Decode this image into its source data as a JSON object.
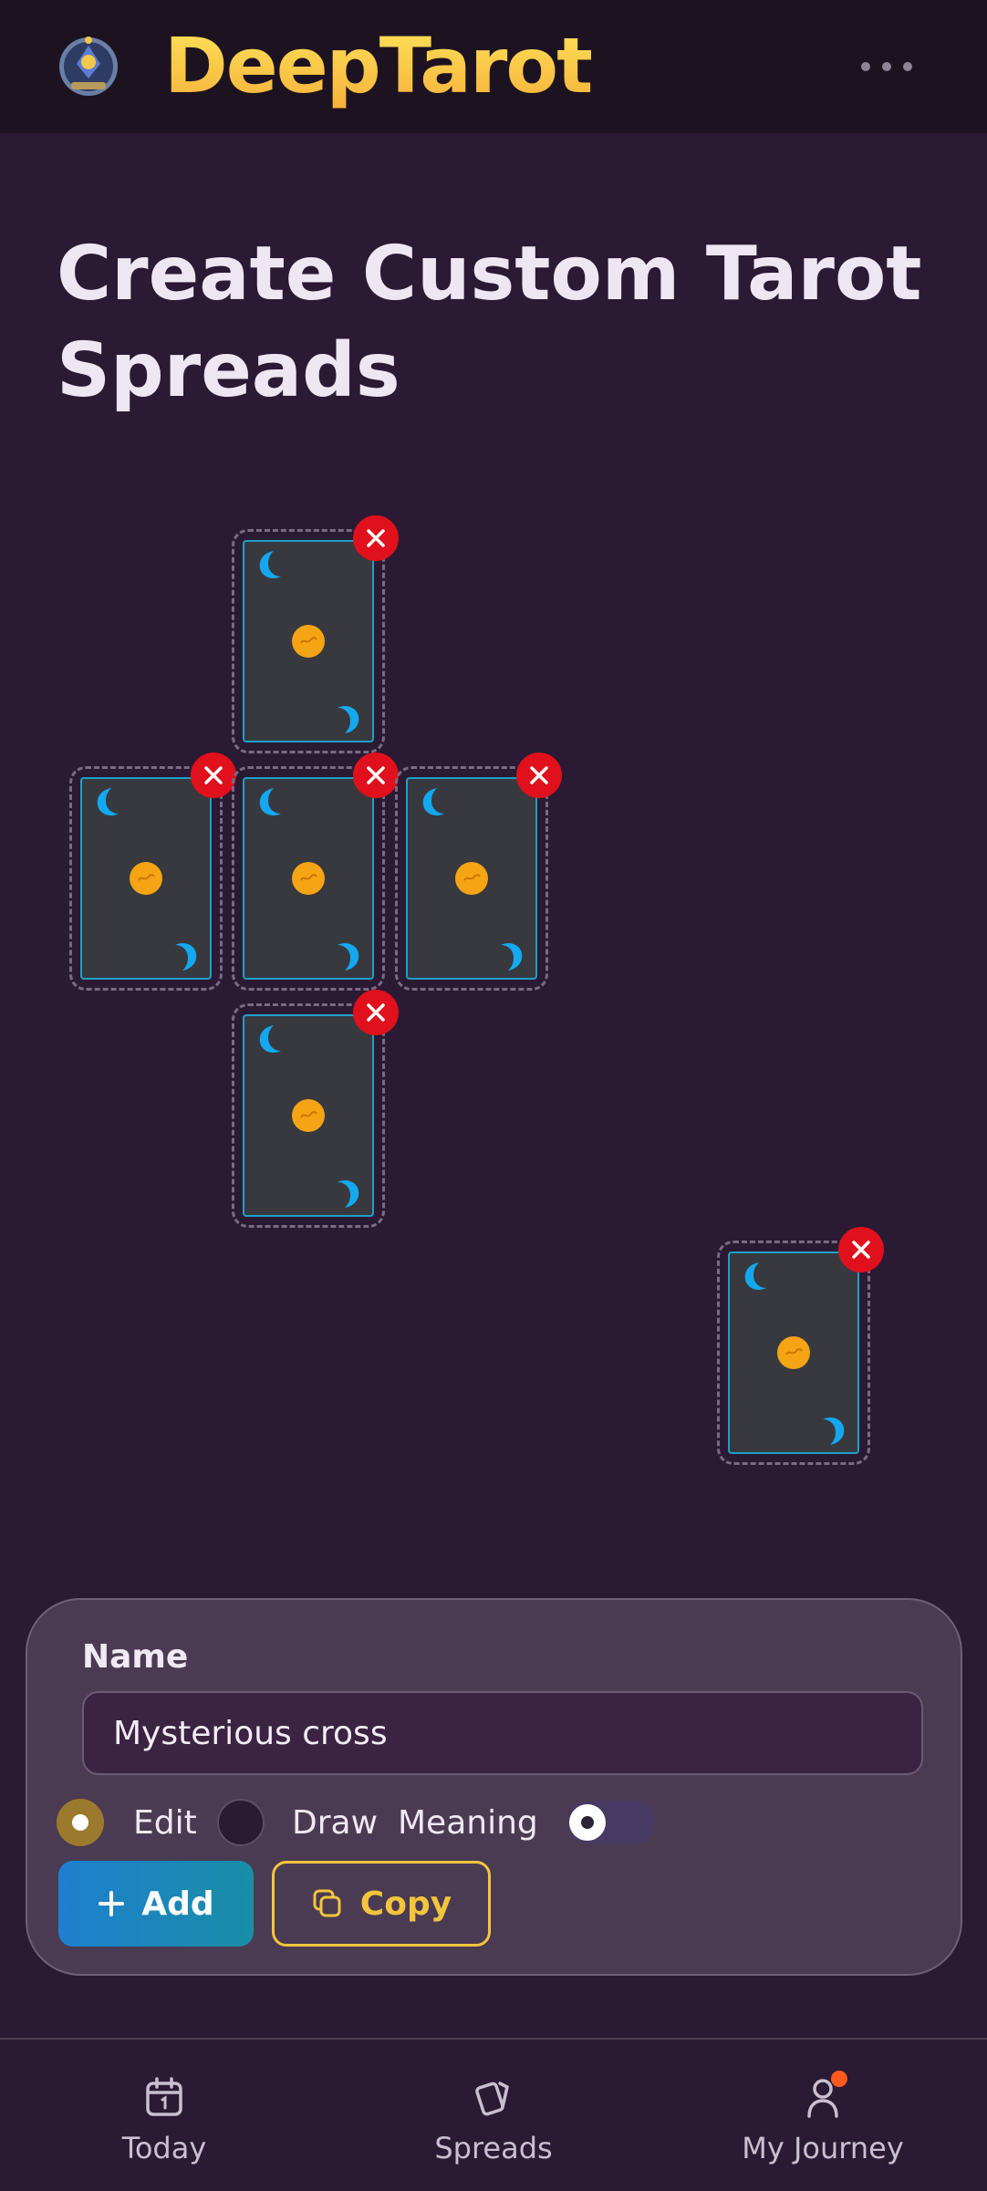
{
  "header": {
    "brand": "DeepTarot",
    "logo_icon": "crystal-ball-emblem-icon",
    "more_icon": "more-dots-icon"
  },
  "page": {
    "title": "Create Custom Tarot Spreads"
  },
  "spread": {
    "card_count": 6,
    "card_icon": "card-back-icon",
    "remove_icon": "close-icon",
    "colors": {
      "card_bg": "#37393f",
      "card_border": "#1ea0c7",
      "sun": "#f5a414",
      "moon": "#14a8f0",
      "remove": "#e0101c"
    }
  },
  "editor": {
    "name_label": "Name",
    "name_value": "Mysterious cross",
    "mode_options": [
      {
        "label": "Edit",
        "selected": true
      },
      {
        "label": "Draw",
        "selected": false
      }
    ],
    "meaning_label": "Meaning",
    "meaning_toggle_on": false,
    "add_label": "Add",
    "copy_label": "Copy"
  },
  "nav": {
    "items": [
      {
        "label": "Today",
        "icon": "calendar-icon"
      },
      {
        "label": "Spreads",
        "icon": "cards-icon"
      },
      {
        "label": "My Journey",
        "icon": "user-icon",
        "badge": true
      }
    ]
  },
  "colors": {
    "background": "#2b1a33",
    "header_bg": "#1d1320",
    "accent_gold": "#f3c43d",
    "accent_blue": "#1f7fcf"
  }
}
